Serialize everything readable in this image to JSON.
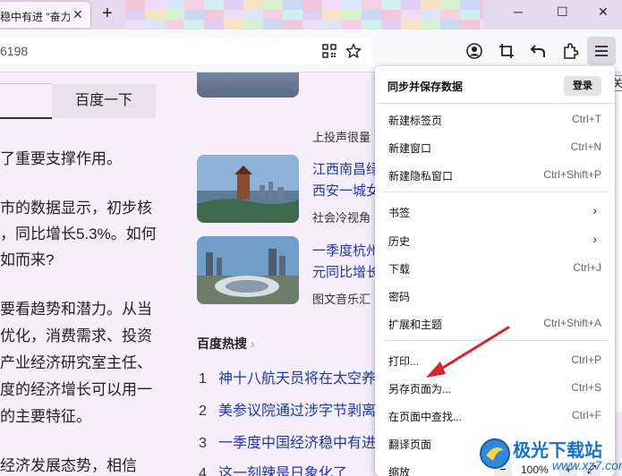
{
  "tab": {
    "title": "稳中有进 \"奋力",
    "close": "✕"
  },
  "window": {
    "minimize": "─",
    "maximize": "☐",
    "close": "✕",
    "new_tab": "+"
  },
  "address": {
    "value": "6198"
  },
  "search": {
    "button_label": "百度一下"
  },
  "article": {
    "lines": [
      "了重要支撑作用。",
      "市的数据显示，初步核",
      "，同比增长5.3%。如何",
      "如而来?",
      "要看趋势和潜力。从当",
      "优化，消费需求、投资",
      "产业经济研究室主任、",
      "度的经济增长可以用一",
      "的主要特征。",
      "经济发展态势，相信"
    ]
  },
  "news": [
    {
      "title_line1": "",
      "title_line2": "",
      "source": "上投声很量"
    },
    {
      "title_line1": "江西南昌绿",
      "title_line2": "西安一城女",
      "source": "社会冷视角"
    },
    {
      "title_line1": "一季度杭州",
      "title_line2": "元同比增长",
      "source": "图文音乐汇"
    }
  ],
  "hot": {
    "heading": "百度热搜",
    "items": [
      {
        "num": "1",
        "text": "神十八航天员将在太空养"
      },
      {
        "num": "2",
        "text": "美参议院通过涉字节剥离"
      },
      {
        "num": "3",
        "text": "一季度中国经济稳中有进"
      },
      {
        "num": "4",
        "text": "这一刻辣是日象化了"
      }
    ]
  },
  "menu": {
    "sync_label": "同步并保存数据",
    "login_label": "登录",
    "items": [
      {
        "label": "新建标签页",
        "shortcut": "Ctrl+T"
      },
      {
        "label": "新建窗口",
        "shortcut": "Ctrl+N"
      },
      {
        "label": "新建隐私窗口",
        "shortcut": "Ctrl+Shift+P"
      },
      {
        "label": "书签",
        "shortcut": ""
      },
      {
        "label": "历史",
        "shortcut": ""
      },
      {
        "label": "下载",
        "shortcut": "Ctrl+J"
      },
      {
        "label": "密码",
        "shortcut": ""
      },
      {
        "label": "扩展和主题",
        "shortcut": "Ctrl+Shift+A"
      },
      {
        "label": "打印...",
        "shortcut": "Ctrl+P"
      },
      {
        "label": "另存页面为...",
        "shortcut": "Ctrl+S"
      },
      {
        "label": "在页面中查找...",
        "shortcut": "Ctrl+F"
      },
      {
        "label": "翻译页面",
        "shortcut": ""
      },
      {
        "label": "缩放",
        "shortcut": ""
      }
    ],
    "zoom": {
      "minus": "−",
      "value": "100%",
      "plus": "+",
      "fullscreen": "⤢"
    }
  },
  "side_tip": "关",
  "watermark": {
    "text": "极光下载站",
    "url": "www.xz7.com"
  },
  "colors": {
    "accent": "#1a3aa8",
    "arrow": "#d9262b",
    "panel": "#ffffff"
  }
}
